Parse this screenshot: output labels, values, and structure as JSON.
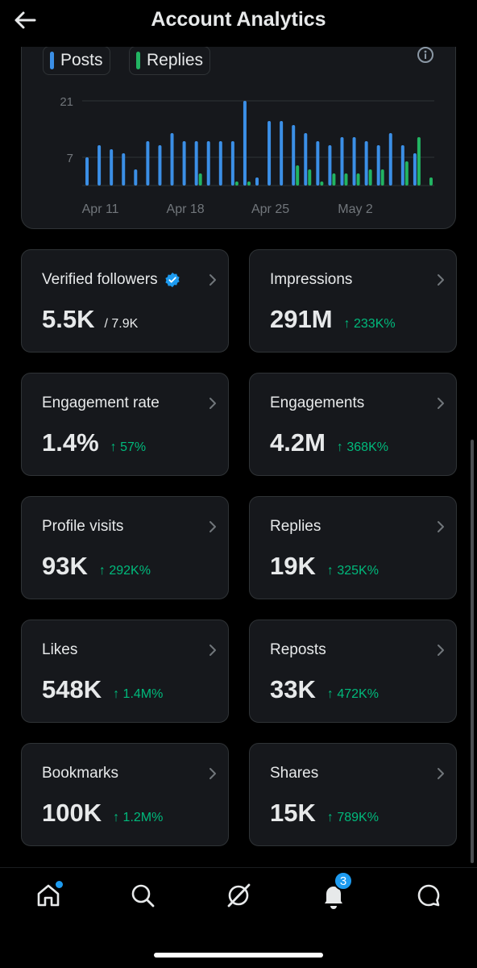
{
  "header": {
    "title": "Account Analytics"
  },
  "legend": {
    "posts_label": "Posts",
    "replies_label": "Replies"
  },
  "colors": {
    "posts": "#3b8fe6",
    "replies": "#22b462",
    "positive": "#00ba7c",
    "verified": "#1d9bf0"
  },
  "chart_data": {
    "type": "bar",
    "x": [
      "Apr 10",
      "Apr 11",
      "Apr 12",
      "Apr 13",
      "Apr 14",
      "Apr 15",
      "Apr 16",
      "Apr 17",
      "Apr 18",
      "Apr 19",
      "Apr 20",
      "Apr 21",
      "Apr 22",
      "Apr 23",
      "Apr 24",
      "Apr 25",
      "Apr 26",
      "Apr 27",
      "Apr 28",
      "Apr 29",
      "Apr 30",
      "May 1",
      "May 2",
      "May 3",
      "May 4",
      "May 5",
      "May 6",
      "May 7",
      "May 8"
    ],
    "x_tick_labels": [
      "Apr 11",
      "Apr 18",
      "Apr 25",
      "May 2"
    ],
    "y_tick_labels": [
      "7",
      "21"
    ],
    "ylim": [
      0,
      24
    ],
    "grid": true,
    "series": [
      {
        "name": "Posts",
        "values": [
          7,
          10,
          9,
          8,
          4,
          11,
          10,
          13,
          11,
          11,
          11,
          11,
          11,
          21,
          2,
          16,
          16,
          15,
          13,
          11,
          10,
          12,
          12,
          11,
          10,
          13,
          10,
          8,
          0
        ]
      },
      {
        "name": "Replies",
        "values": [
          0,
          0,
          0,
          0,
          0,
          0,
          0,
          0,
          0,
          3,
          0,
          0,
          1,
          1,
          0,
          0,
          0,
          5,
          4,
          1,
          3,
          3,
          3,
          4,
          4,
          0,
          6,
          12,
          2
        ]
      }
    ]
  },
  "stats": [
    {
      "label": "Verified followers",
      "value": "5.5K",
      "sub": "/ 7.9K",
      "verified": true
    },
    {
      "label": "Impressions",
      "value": "291M",
      "delta": "↑ 233K%"
    },
    {
      "label": "Engagement rate",
      "value": "1.4%",
      "delta": "↑ 57%"
    },
    {
      "label": "Engagements",
      "value": "4.2M",
      "delta": "↑ 368K%"
    },
    {
      "label": "Profile visits",
      "value": "93K",
      "delta": "↑ 292K%"
    },
    {
      "label": "Replies",
      "value": "19K",
      "delta": "↑ 325K%"
    },
    {
      "label": "Likes",
      "value": "548K",
      "delta": "↑ 1.4M%"
    },
    {
      "label": "Reposts",
      "value": "33K",
      "delta": "↑ 472K%"
    },
    {
      "label": "Bookmarks",
      "value": "100K",
      "delta": "↑ 1.2M%"
    },
    {
      "label": "Shares",
      "value": "15K",
      "delta": "↑ 789K%"
    }
  ],
  "tabbar": {
    "notifications_count": "3",
    "icons": [
      "home-icon",
      "search-icon",
      "grok-icon",
      "bell-icon",
      "messages-icon"
    ]
  }
}
